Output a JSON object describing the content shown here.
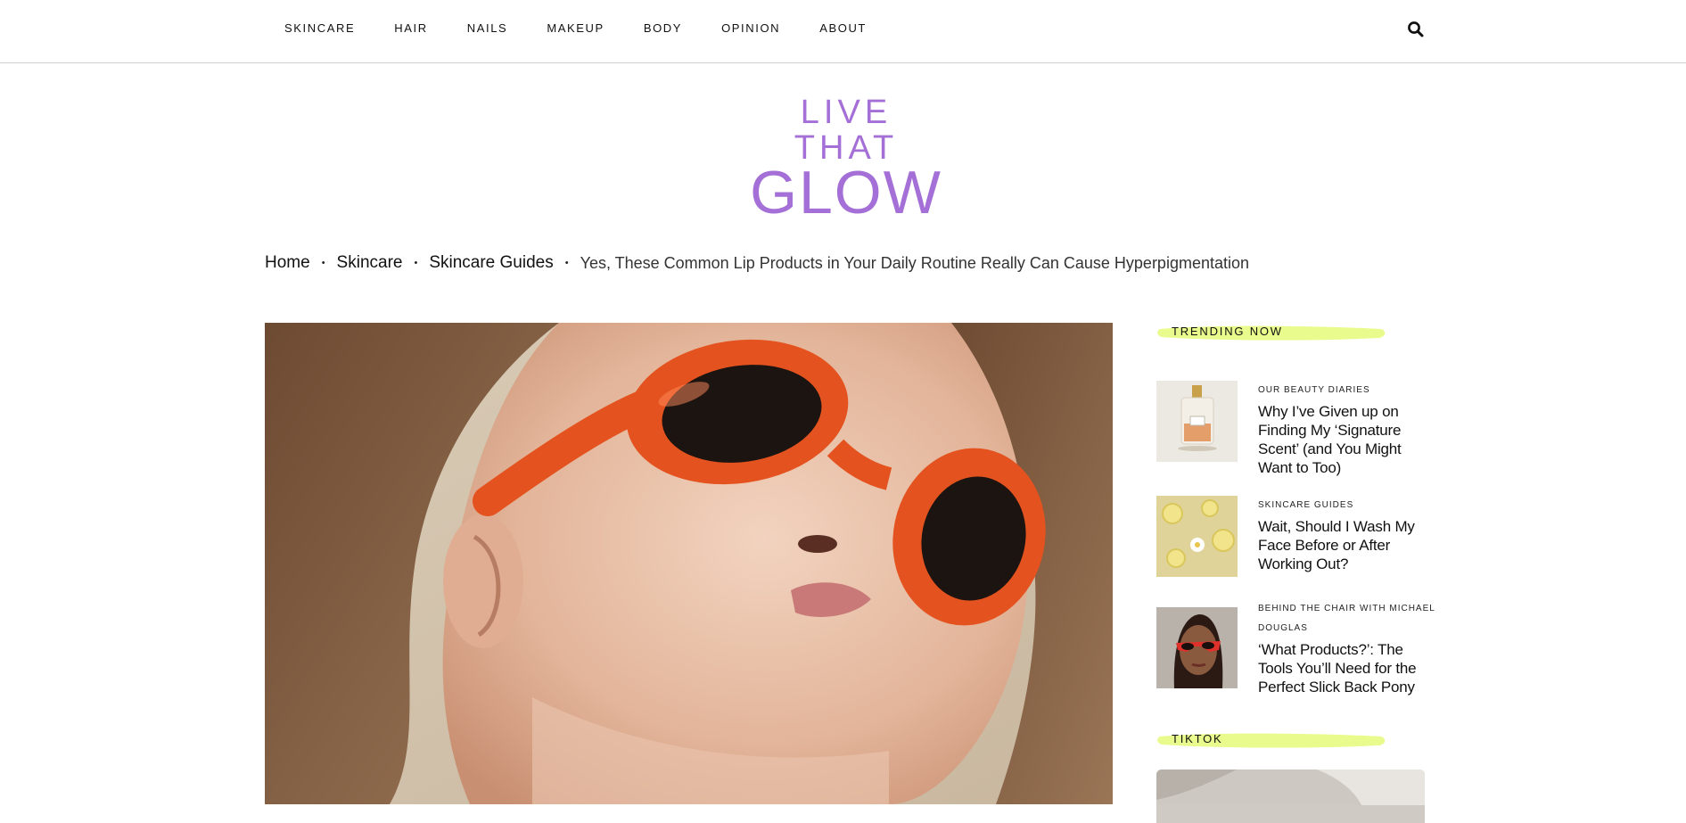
{
  "nav": {
    "items": [
      {
        "label": "SKINCARE"
      },
      {
        "label": "HAIR"
      },
      {
        "label": "NAILS"
      },
      {
        "label": "MAKEUP"
      },
      {
        "label": "BODY"
      },
      {
        "label": "OPINION"
      },
      {
        "label": "ABOUT"
      }
    ],
    "search_icon": "search-icon"
  },
  "logo": {
    "line1": "LIVE THAT",
    "line2": "GLOW",
    "color": "#a46fd6"
  },
  "breadcrumb": {
    "items": [
      "Home",
      "Skincare",
      "Skincare Guides"
    ],
    "separator": "•",
    "current": "Yes, These Common Lip Products in Your Daily Routine Really Can Cause Hyperpigmentation"
  },
  "sidebar": {
    "trending_title": "TRENDING NOW",
    "highlight_color": "#e9fb8c",
    "items": [
      {
        "category": "OUR BEAUTY DIARIES",
        "title": "Why I’ve Given up on Finding My ‘Signature Scent’ (and You Might Want to Too)"
      },
      {
        "category": "SKINCARE GUIDES",
        "title": "Wait, Should I Wash My Face Before or After Working Out?"
      },
      {
        "category": "BEHIND THE CHAIR WITH MICHAEL DOUGLAS",
        "title": "‘What Products?’: The Tools You’ll Need for the Perfect Slick Back Pony"
      }
    ],
    "tiktok_title": "TIKTOK"
  }
}
